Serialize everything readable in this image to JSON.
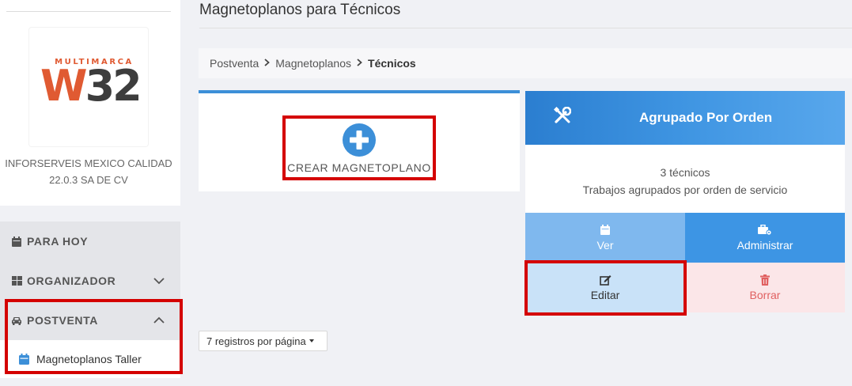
{
  "sidebar": {
    "logo": {
      "top_text": "MULTIMARCA",
      "letter": "W",
      "number": "32"
    },
    "company": {
      "line1": "INFORSERVEIS MEXICO CALIDAD",
      "line2": "22.0.3 SA DE CV"
    },
    "menu": [
      {
        "label": "PARA HOY",
        "icon": "calendar-icon"
      },
      {
        "label": "ORGANIZADOR",
        "icon": "grid-icon"
      },
      {
        "label": "POSTVENTA",
        "icon": "car-icon"
      }
    ],
    "submenu": [
      {
        "label": "Magnetoplanos Taller",
        "icon": "calendar-icon"
      }
    ]
  },
  "page": {
    "title": "Magnetoplanos para Técnicos"
  },
  "breadcrumb": {
    "items": [
      "Postventa",
      "Magnetoplanos",
      "Técnicos"
    ]
  },
  "create_card": {
    "label": "CREAR MAGNETOPLANO"
  },
  "group_card": {
    "title": "Agrupado Por Orden",
    "count": "3 técnicos",
    "description": "Trabajos agrupados por orden de servicio",
    "buttons": {
      "ver": "Ver",
      "administrar": "Administrar",
      "editar": "Editar",
      "borrar": "Borrar"
    }
  },
  "pagination": {
    "per_page": "7 registros por página"
  },
  "colors": {
    "primary": "#3c8fd8",
    "highlight": "#d40000",
    "danger": "#e06060",
    "logo_orange": "#e05a32"
  }
}
